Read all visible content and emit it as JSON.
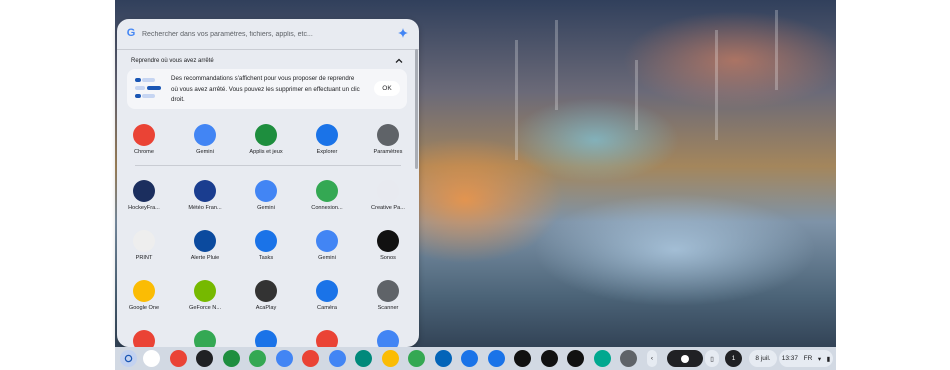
{
  "search": {
    "placeholder": "Rechercher dans vos paramètres, fichiers, applis, etc..."
  },
  "continue_section": {
    "header": "Reprendre où vous avez arrêté",
    "message_lines": [
      "Des recommandations s'affichent pour vous proposer de reprendre",
      "où vous avez arrêté. Vous pouvez les supprimer en effectuant un clic",
      "droit."
    ],
    "ok_label": "OK"
  },
  "apps_top": [
    {
      "label": "Chrome",
      "icon": "chrome-icon",
      "color": "#ea4335"
    },
    {
      "label": "Gemini",
      "icon": "gemini-icon",
      "color": "#4285f4"
    },
    {
      "label": "Applis et jeux",
      "icon": "apps-games-icon",
      "color": "#1e8e3e"
    },
    {
      "label": "Explorer",
      "icon": "explore-icon",
      "color": "#1a73e8"
    },
    {
      "label": "Paramètres",
      "icon": "settings-icon",
      "color": "#5f6368"
    }
  ],
  "apps_grid": [
    {
      "label": "HockeyFra...",
      "icon": "hockey-icon",
      "color": "#1b2e5e"
    },
    {
      "label": "Météo Fran...",
      "icon": "weather-icon",
      "color": "#1a3d8f"
    },
    {
      "label": "Gemini",
      "icon": "gemini-icon",
      "color": "#4285f4"
    },
    {
      "label": "Connexion...",
      "icon": "connexion-icon",
      "color": "#34a853"
    },
    {
      "label": "Creative Pa...",
      "icon": "creative-icon",
      "color": "#e8eaf0"
    },
    {
      "label": "PRINT",
      "icon": "print-icon",
      "color": "#eeeeee"
    },
    {
      "label": "Alerte Pluie",
      "icon": "rain-alert-icon",
      "color": "#0b4a9e"
    },
    {
      "label": "Tasks",
      "icon": "tasks-icon",
      "color": "#1a73e8"
    },
    {
      "label": "Gemini",
      "icon": "gemini-icon",
      "color": "#4285f4"
    },
    {
      "label": "Sonos",
      "icon": "sonos-icon",
      "color": "#111111"
    },
    {
      "label": "Google One",
      "icon": "google-one-icon",
      "color": "#fbbc04"
    },
    {
      "label": "GeForce N...",
      "icon": "geforce-icon",
      "color": "#76b900"
    },
    {
      "label": "AcaPlay",
      "icon": "acaplay-icon",
      "color": "#333333"
    },
    {
      "label": "Caméra",
      "icon": "camera-icon",
      "color": "#1a73e8"
    },
    {
      "label": "Scanner",
      "icon": "scanner-icon",
      "color": "#5f6368"
    },
    {
      "label": "",
      "icon": "chrome-icon",
      "color": "#ea4335"
    },
    {
      "label": "",
      "icon": "play-store-icon",
      "color": "#34a853"
    },
    {
      "label": "",
      "icon": "files-icon",
      "color": "#1a73e8"
    },
    {
      "label": "",
      "icon": "gmail-icon",
      "color": "#ea4335"
    },
    {
      "label": "",
      "icon": "docs-icon",
      "color": "#4285f4"
    }
  ],
  "shelf": {
    "apps": [
      {
        "icon": "gemini-icon",
        "color": "#ffffff"
      },
      {
        "icon": "chrome-icon",
        "color": "#ea4335"
      },
      {
        "icon": "cast-icon",
        "color": "#202124"
      },
      {
        "icon": "apps-games-icon",
        "color": "#1e8e3e"
      },
      {
        "icon": "play-store-icon",
        "color": "#34a853"
      },
      {
        "icon": "calendar-icon",
        "color": "#4285f4"
      },
      {
        "icon": "gmail-icon",
        "color": "#ea4335"
      },
      {
        "icon": "docs-icon",
        "color": "#4285f4"
      },
      {
        "icon": "meet-icon",
        "color": "#00897b"
      },
      {
        "icon": "photos-icon",
        "color": "#fbbc04"
      },
      {
        "icon": "connexion-icon",
        "color": "#34a853"
      },
      {
        "icon": "onedrive-icon",
        "color": "#0364b8"
      },
      {
        "icon": "explore-icon",
        "color": "#1a73e8"
      },
      {
        "icon": "files-icon",
        "color": "#1a73e8"
      },
      {
        "icon": "sonos-icon",
        "color": "#111111"
      },
      {
        "icon": "add-icon",
        "color": "#111111"
      },
      {
        "icon": "netflix-icon",
        "color": "#111111"
      },
      {
        "icon": "picsart-icon",
        "color": "#00a88f"
      },
      {
        "icon": "scanner-icon",
        "color": "#5f6368"
      }
    ],
    "date": "8 juil.",
    "time": "13:37",
    "lang": "FR",
    "notification_count": "1"
  }
}
